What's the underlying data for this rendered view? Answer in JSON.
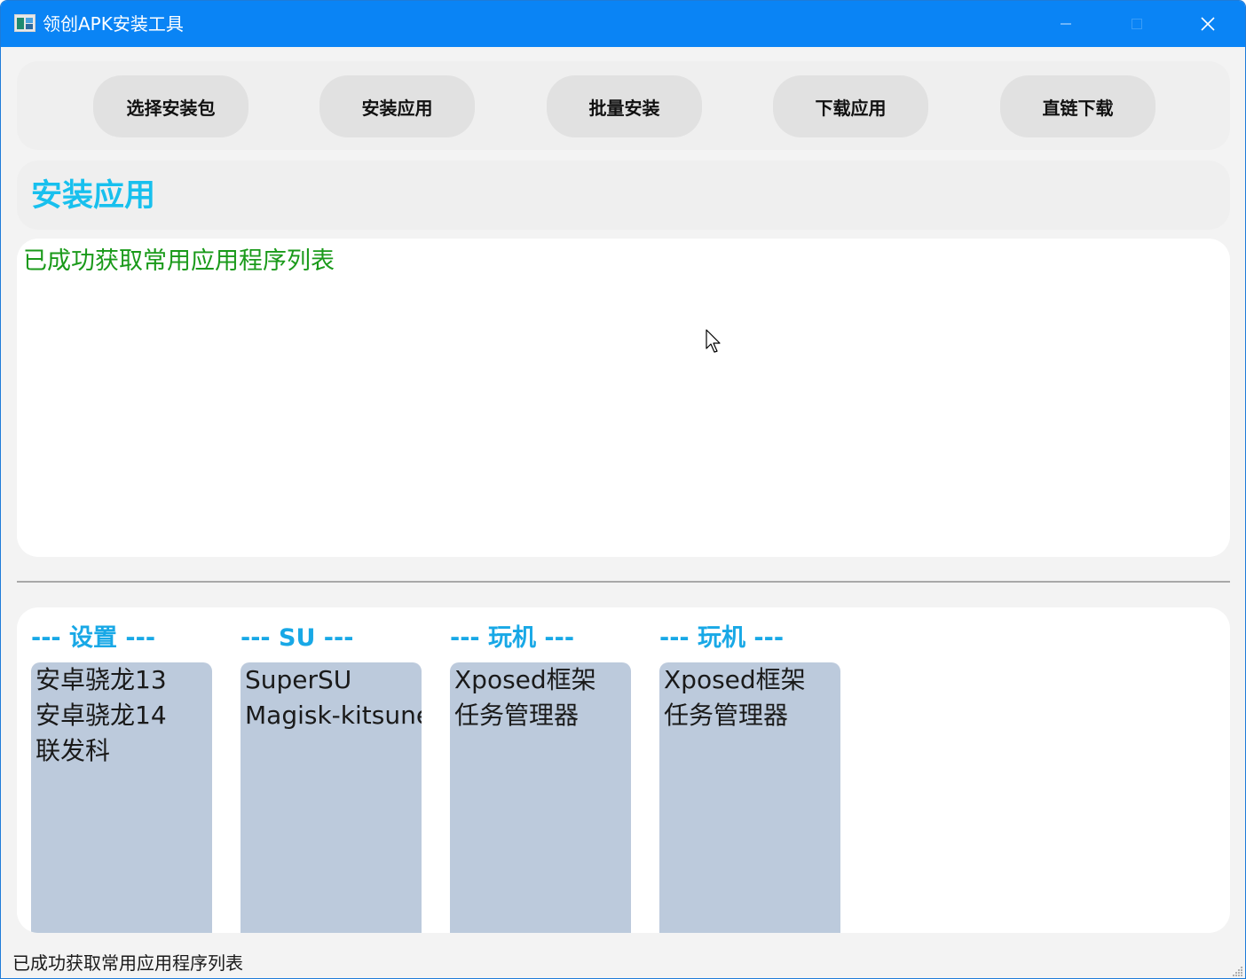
{
  "window": {
    "title": "领创APK安装工具",
    "controls": [
      "minimize-icon",
      "maximize-icon",
      "close-icon"
    ],
    "accent": "#0a84f5"
  },
  "toolbar": {
    "buttons": [
      {
        "label": "选择安装包"
      },
      {
        "label": "安装应用"
      },
      {
        "label": "批量安装"
      },
      {
        "label": "下载应用"
      },
      {
        "label": "直链下载"
      }
    ]
  },
  "section": {
    "title": "安装应用",
    "title_color": "#18c0ee"
  },
  "log": {
    "message": "已成功获取常用应用程序列表",
    "message_color": "#1a9a1a"
  },
  "categories": [
    {
      "heading": "--- 设置 ---",
      "items": [
        "安卓骁龙13",
        "安卓骁龙14",
        "联发科"
      ]
    },
    {
      "heading": "--- SU ---",
      "items": [
        "SuperSU",
        "Magisk-kitsune"
      ]
    },
    {
      "heading": "--- 玩机 ---",
      "items": [
        "Xposed框架",
        "任务管理器"
      ]
    },
    {
      "heading": "--- 玩机 ---",
      "items": [
        "Xposed框架",
        "任务管理器"
      ]
    }
  ],
  "status_bar": {
    "text": "已成功获取常用应用程序列表"
  }
}
